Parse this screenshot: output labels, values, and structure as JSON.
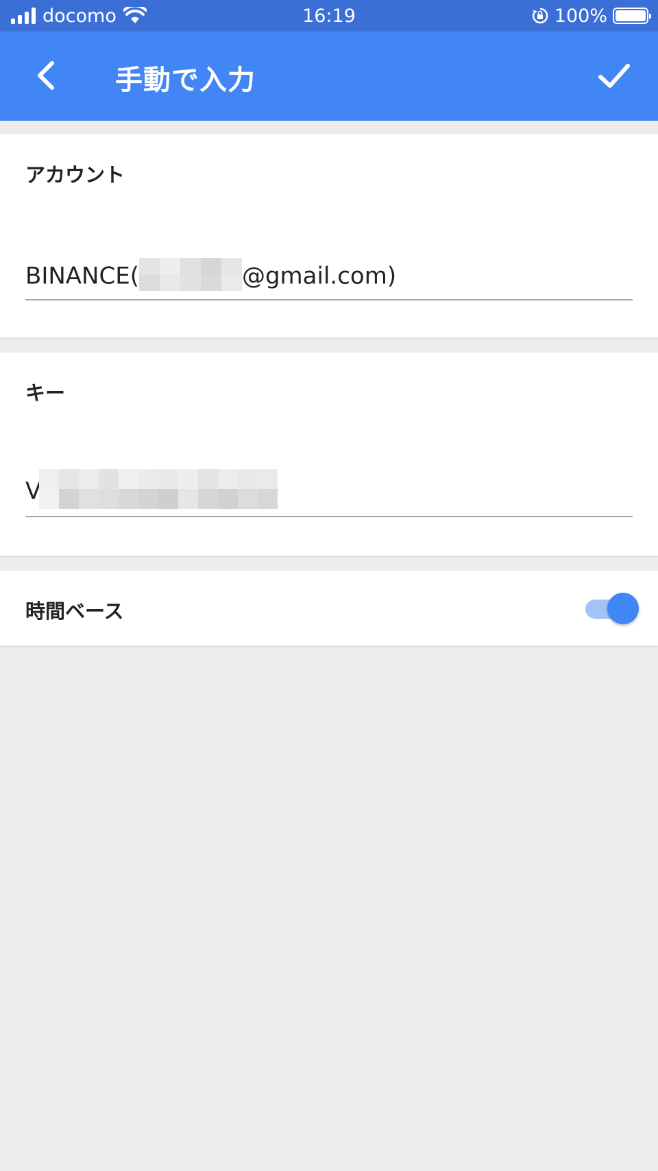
{
  "status_bar": {
    "carrier": "docomo",
    "time": "16:19",
    "battery_percent": "100%",
    "icons": [
      "signal-icon",
      "wifi-icon",
      "rotation-lock-icon",
      "battery-icon"
    ]
  },
  "app_bar": {
    "title": "手動で入力",
    "back_icon": "back-arrow-icon",
    "confirm_icon": "check-icon",
    "color": "#4285f4"
  },
  "account_section": {
    "label": "アカウント",
    "value_prefix": "BINANCE(",
    "value_suffix": "@gmail.com)"
  },
  "key_section": {
    "label": "キー",
    "value_prefix": "V"
  },
  "time_based_section": {
    "label": "時間ベース",
    "toggle_on": true
  },
  "colors": {
    "accent": "#4285f4",
    "status_bar": "#3b6fd6",
    "background": "#ededed"
  }
}
